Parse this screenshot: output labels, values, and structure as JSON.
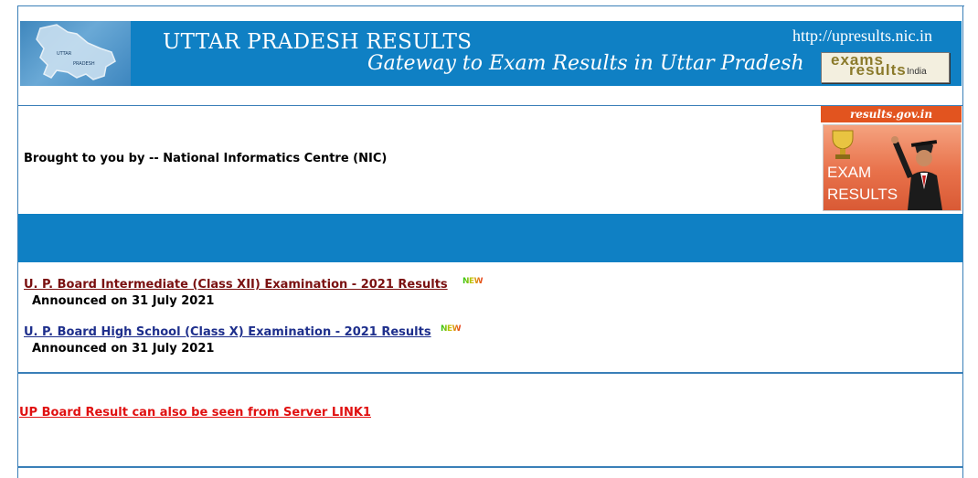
{
  "header": {
    "title": "UTTAR PRADESH RESULTS",
    "tagline": "Gateway to Exam Results in Uttar Pradesh",
    "url": "http://upresults.nic.in",
    "map_logo_text": [
      "UTTAR",
      "PRADESH"
    ],
    "exams_results_logo": {
      "line1": "exams",
      "line2": "results",
      "line3": "India"
    }
  },
  "info": {
    "brought_by": "Brought to you by -- National Informatics Centre (NIC)"
  },
  "gov_badge": {
    "header": "results.gov.in",
    "line1": "EXAM",
    "line2": "RESULTS"
  },
  "results": [
    {
      "label": "U. P. Board Intermediate (Class XII) Examination  - 2021 Results",
      "badge": "NEW",
      "announced": "Announced on 31 July 2021"
    },
    {
      "label": "U. P. Board High School (Class X) Examination - 2021 Results ",
      "badge": "NEW",
      "announced": "Announced on 31 July 2021"
    }
  ],
  "server_link": "UP Board Result can also be seen from Server LINK1",
  "colors": {
    "banner_blue": "#0f80c4",
    "border_blue": "#3a7fb8",
    "link_maroon": "#7a1010",
    "link_navy": "#1e2f8c",
    "link_red": "#e01010",
    "badge_orange": "#e2541f"
  }
}
